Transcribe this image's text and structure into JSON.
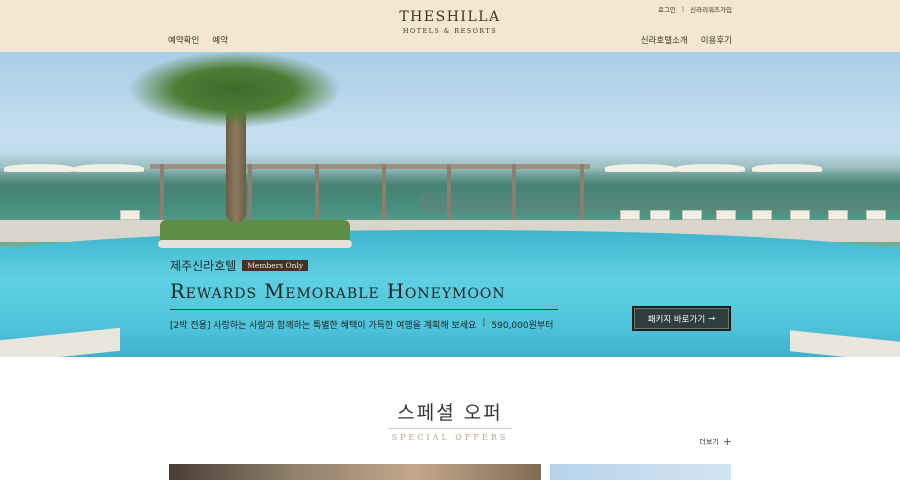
{
  "header": {
    "logo_main": "THESHILLA",
    "logo_sub": "HOTELS & RESORTS",
    "util_links": [
      "로그인",
      "신라리워즈가입"
    ],
    "util_separator": "|",
    "nav_left": [
      "예약확인",
      "예약"
    ],
    "nav_right": [
      "신라호텔소개",
      "이용후기"
    ]
  },
  "hero": {
    "kicker": "제주신라호텔",
    "badge": "Members Only",
    "title": "Rewards Memorable Honeymoon",
    "description": "[2박 전용] 사랑하는 사람과 함께하는 특별한 혜택이 가득한 여행을 계획해 보세요",
    "separator": "|",
    "price": "590,000원부터",
    "button_label": "패키지 바로가기",
    "button_arrow": "→"
  },
  "special_offers": {
    "title": "스페셜 오퍼",
    "subtitle": "SPECIAL OFFERS",
    "more_label": "더보기",
    "more_icon": "+"
  },
  "colors": {
    "header_bg": "#f3e7d2",
    "badge_bg": "#4a2f27",
    "button_bg": "#2f3e3c",
    "subtitle": "#b1a58f"
  }
}
